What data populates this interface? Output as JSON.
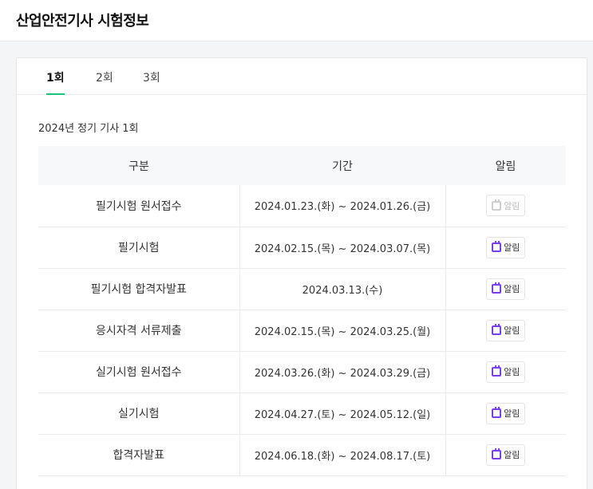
{
  "page": {
    "title": "산업안전기사 시험정보"
  },
  "tabs": [
    {
      "label": "1회",
      "active": true
    },
    {
      "label": "2회",
      "active": false
    },
    {
      "label": "3회",
      "active": false
    }
  ],
  "section": {
    "title": "2024년 정기 기사 1회"
  },
  "table": {
    "headers": [
      "구분",
      "기간",
      "알림"
    ],
    "rows": [
      {
        "type": "필기시험 원서접수",
        "period": "2024.01.23.(화) ~ 2024.01.26.(금)",
        "alarm": "알림",
        "alarm_enabled": false
      },
      {
        "type": "필기시험",
        "period": "2024.02.15.(목) ~ 2024.03.07.(목)",
        "alarm": "알림",
        "alarm_enabled": true
      },
      {
        "type": "필기시험 합격자발표",
        "period": "2024.03.13.(수)",
        "alarm": "알림",
        "alarm_enabled": true
      },
      {
        "type": "응시자격 서류제출",
        "period": "2024.02.15.(목) ~ 2024.03.25.(월)",
        "alarm": "알림",
        "alarm_enabled": true
      },
      {
        "type": "실기시험 원서접수",
        "period": "2024.03.26.(화) ~ 2024.03.29.(금)",
        "alarm": "알림",
        "alarm_enabled": true
      },
      {
        "type": "실기시험",
        "period": "2024.04.27.(토) ~ 2024.05.12.(일)",
        "alarm": "알림",
        "alarm_enabled": true
      },
      {
        "type": "합격자발표",
        "period": "2024.06.18.(화) ~ 2024.08.17.(토)",
        "alarm": "알림",
        "alarm_enabled": true
      }
    ]
  },
  "colors": {
    "accent_tab": "#19c37d",
    "calendar_icon": "#7a3ff0"
  },
  "icons": {
    "alarm": "calendar-icon"
  }
}
